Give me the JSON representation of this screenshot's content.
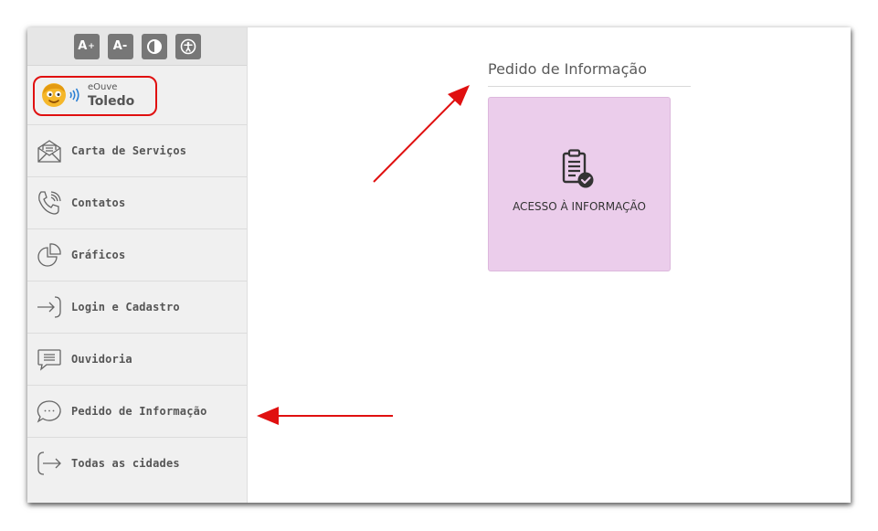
{
  "accessibility": {
    "increase_font": "A",
    "increase_sup": "+",
    "decrease_font": "A-"
  },
  "brand": {
    "subtitle": "eOuve",
    "name": "Toledo"
  },
  "menu": [
    {
      "label": "Carta de Serviços",
      "icon": "envelope-icon"
    },
    {
      "label": "Contatos",
      "icon": "phone-icon"
    },
    {
      "label": "Gráficos",
      "icon": "pie-chart-icon"
    },
    {
      "label": "Login e Cadastro",
      "icon": "login-arrow-icon"
    },
    {
      "label": "Ouvidoria",
      "icon": "message-icon"
    },
    {
      "label": "Pedido de Informação",
      "icon": "chat-bubble-icon"
    },
    {
      "label": "Todas as cidades",
      "icon": "exit-arrow-icon"
    }
  ],
  "main": {
    "section_title": "Pedido de Informação",
    "card": {
      "label": "ACESSO À INFORMAÇÃO",
      "icon": "clipboard-check-icon",
      "color": "#ebcdeb"
    }
  },
  "colors": {
    "annotation": "#e01010",
    "sidebar_bg": "#f0f0f0",
    "button_gray": "#777777"
  }
}
